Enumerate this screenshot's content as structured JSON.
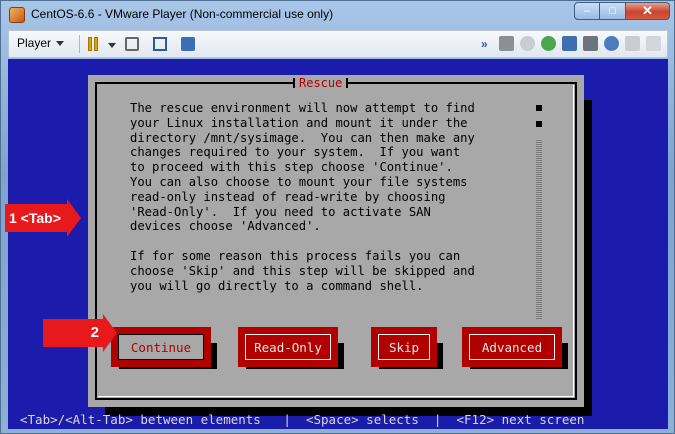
{
  "window": {
    "title": "CentOS-6.6 - VMware Player (Non-commercial use only)",
    "minimize": "–",
    "maximize": "□",
    "close": "✕"
  },
  "toolbar": {
    "player_label": "Player",
    "more_chevron": "»",
    "icons": [
      "pause-icon",
      "network-icon",
      "fullscreen-icon",
      "unity-icon",
      "hard-disk-icon",
      "cd-dvd-icon",
      "usb-icon",
      "network-adapter-icon",
      "printer-icon",
      "sound-icon",
      "display-icon",
      "message-log-icon"
    ]
  },
  "dialog": {
    "title": "Rescue",
    "body": "The rescue environment will now attempt to find\nyour Linux installation and mount it under the\ndirectory /mnt/sysimage.  You can then make any\nchanges required to your system.  If you want\nto proceed with this step choose 'Continue'.\nYou can also choose to mount your file systems\nread-only instead of read-write by choosing\n'Read-Only'.  If you need to activate SAN\ndevices choose 'Advanced'.\n\nIf for some reason this process fails you can\nchoose 'Skip' and this step will be skipped and\nyou will go directly to a command shell.",
    "buttons": {
      "continue": "Continue",
      "read_only": "Read-Only",
      "skip": "Skip",
      "advanced": "Advanced"
    },
    "focused_button": "Continue"
  },
  "status_line": "<Tab>/<Alt-Tab> between elements   |  <Space> selects  |  <F12> next screen",
  "annotations": {
    "step1": "1 <Tab>",
    "step2": "2"
  },
  "colors": {
    "console_bg": "#1c1cac",
    "dialog_bg": "#a8a8a8",
    "button_red": "#b00000",
    "annotation_red": "#e8191d"
  }
}
